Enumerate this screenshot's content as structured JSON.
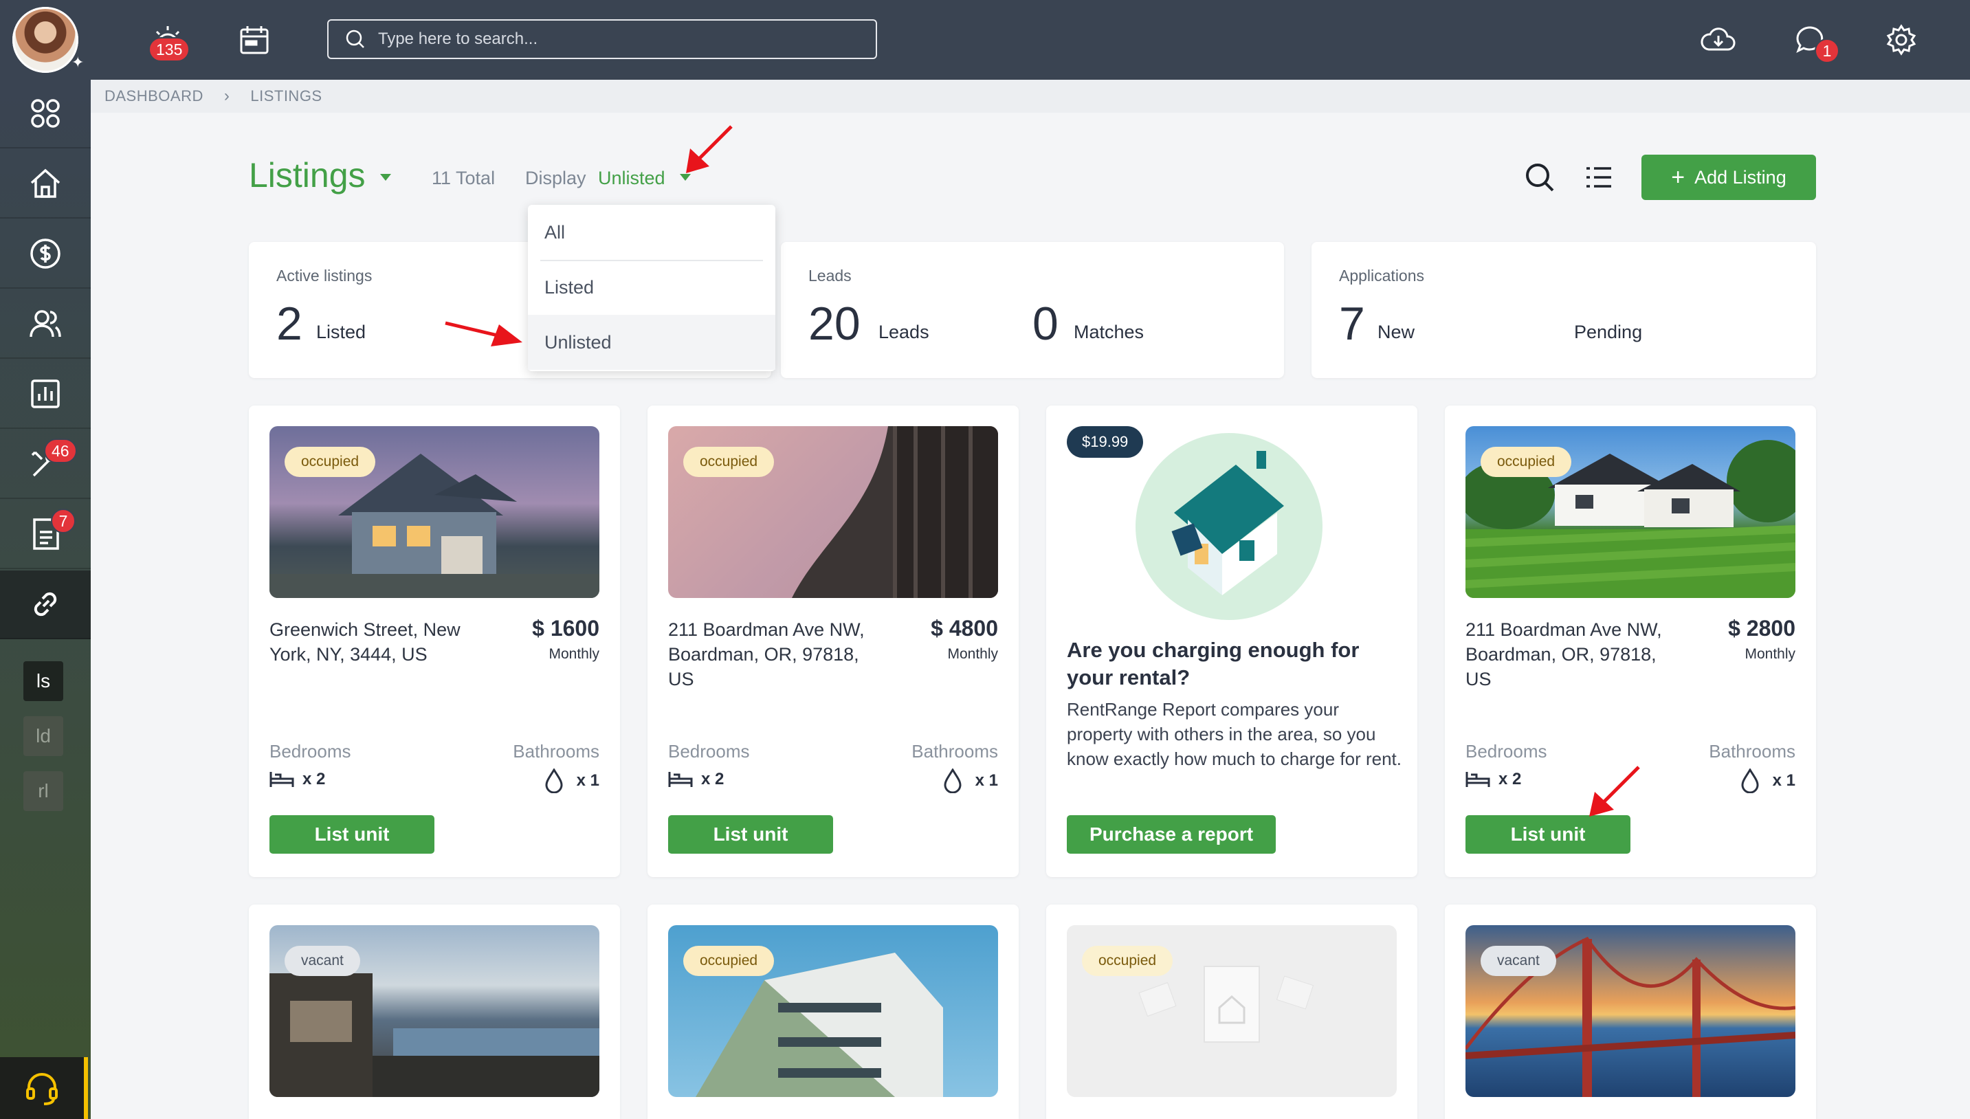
{
  "topbar": {
    "alarm_badge": "135",
    "search_placeholder": "Type here to search...",
    "chat_badge": "1"
  },
  "sidebar": {
    "tools_badge": "46",
    "docs_badge": "7",
    "small_items": [
      "ls",
      "ld",
      "rl"
    ]
  },
  "breadcrumb": [
    "DASHBOARD",
    "LISTINGS"
  ],
  "header": {
    "title": "Listings",
    "total": "11 Total",
    "display_label": "Display",
    "display_value": "Unlisted",
    "add_button": "Add Listing"
  },
  "dropdown": {
    "options": [
      "All",
      "Listed",
      "Unlisted"
    ],
    "selected": "Unlisted"
  },
  "stats": {
    "active": {
      "title": "Active listings",
      "listed_count": "2",
      "listed_label": "Listed"
    },
    "leads": {
      "title": "Leads",
      "leads_count": "20",
      "leads_label": "Leads",
      "matches_count": "0",
      "matches_label": "Matches"
    },
    "applications": {
      "title": "Applications",
      "new_count": "7",
      "new_label": "New",
      "pending_label": "Pending"
    }
  },
  "cards": [
    {
      "status": "occupied",
      "address": "Greenwich Street, New York, NY, 3444, US",
      "price": "$ 1600",
      "period": "Monthly",
      "bed_label": "Bedrooms",
      "bath_label": "Bathrooms",
      "beds": "x 2",
      "baths": "x 1",
      "button": "List unit"
    },
    {
      "status": "occupied",
      "address": "211 Boardman Ave NW, Boardman, OR, 97818, US",
      "price": "$ 4800",
      "period": "Monthly",
      "bed_label": "Bedrooms",
      "bath_label": "Bathrooms",
      "beds": "x 2",
      "baths": "x 1",
      "button": "List unit"
    },
    {
      "status": "occupied",
      "address": "211 Boardman Ave NW, Boardman, OR, 97818, US",
      "price": "$ 2800",
      "period": "Monthly",
      "bed_label": "Bedrooms",
      "bath_label": "Bathrooms",
      "beds": "x 2",
      "baths": "x 1",
      "button": "List unit"
    }
  ],
  "promo": {
    "price": "$19.99",
    "heading": "Are you charging enough for your rental?",
    "text": "RentRange Report compares your property with others in the area, so you know exactly how much to charge for rent.",
    "button": "Purchase a report"
  },
  "row2_tags": [
    "vacant",
    "occupied",
    "occupied",
    "vacant"
  ],
  "colors": {
    "accent": "#43a047",
    "topbar": "#3a4452",
    "badge": "#e3343a",
    "annotation_arrow": "#e8141b"
  }
}
